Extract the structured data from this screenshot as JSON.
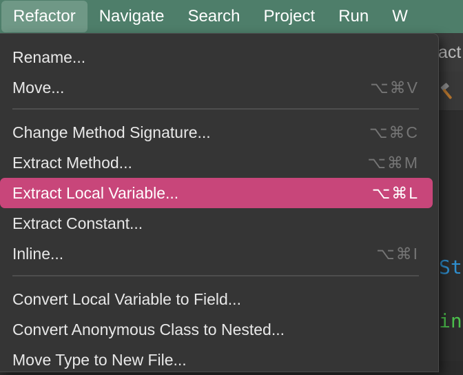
{
  "menubar": {
    "items": [
      "Refactor",
      "Navigate",
      "Search",
      "Project",
      "Run",
      "W"
    ]
  },
  "editor": {
    "title_fragment": "act",
    "code_tokens": [
      {
        "text": "St",
        "color": "#2f8fcf"
      },
      {
        "text": "in",
        "color": "#4cbf4c"
      }
    ]
  },
  "refactor_menu": {
    "highlight_color": "#c8467a",
    "items": [
      {
        "label": "Rename...",
        "shortcut": ""
      },
      {
        "label": "Move...",
        "shortcut": "⌥⌘V"
      },
      {
        "label": "Change Method Signature...",
        "shortcut": "⌥⌘C"
      },
      {
        "label": "Extract Method...",
        "shortcut": "⌥⌘M"
      },
      {
        "label": "Extract Local Variable...",
        "shortcut": "⌥⌘L"
      },
      {
        "label": "Extract Constant...",
        "shortcut": ""
      },
      {
        "label": "Inline...",
        "shortcut": "⌥⌘I"
      },
      {
        "label": "Convert Local Variable to Field...",
        "shortcut": ""
      },
      {
        "label": "Convert Anonymous Class to Nested...",
        "shortcut": ""
      },
      {
        "label": "Move Type to New File...",
        "shortcut": ""
      }
    ]
  }
}
